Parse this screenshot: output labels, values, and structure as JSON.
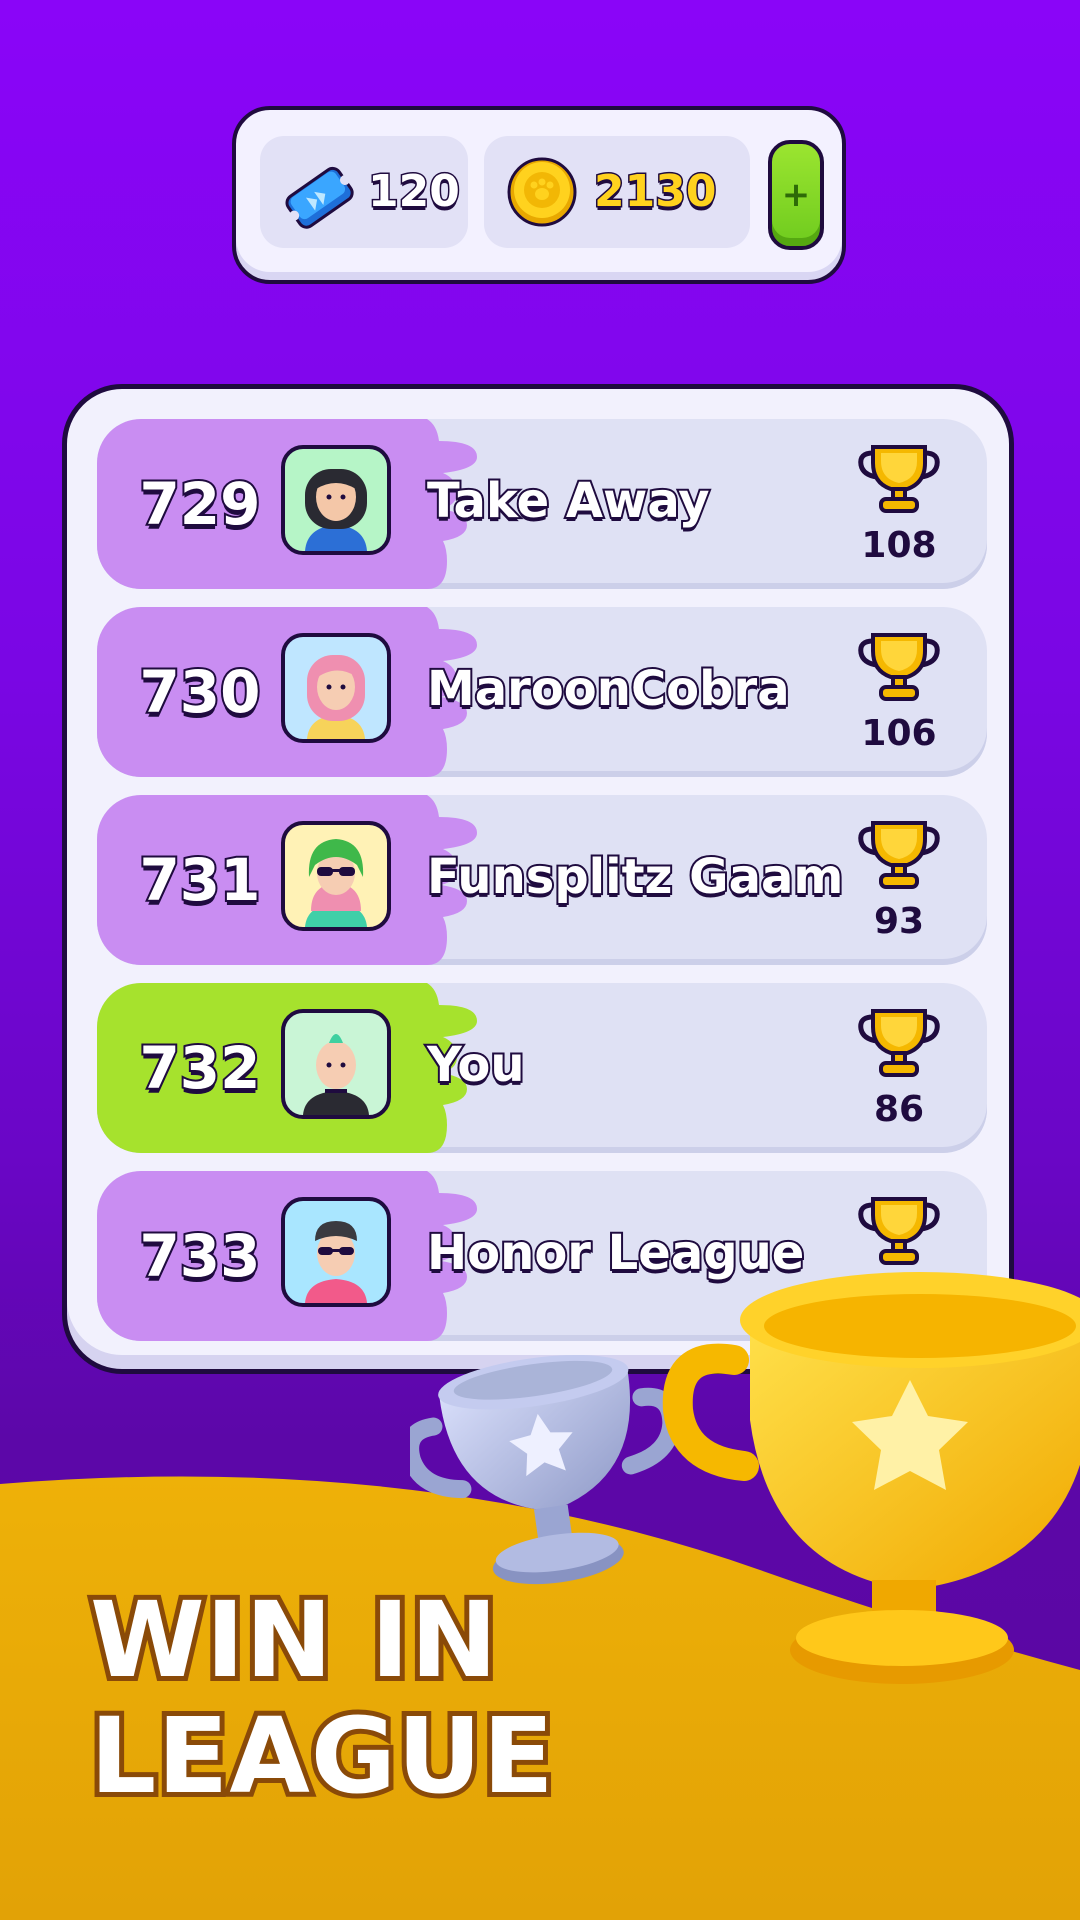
{
  "currency": {
    "tickets_icon": "ticket-icon",
    "tickets": "120",
    "coins_icon": "coin-icon",
    "coins": "2130",
    "add_label": "+"
  },
  "leaderboard": {
    "rows": [
      {
        "rank": "729",
        "name": "Take Away",
        "trophies": "108",
        "highlight": "#c98df2"
      },
      {
        "rank": "730",
        "name": "MaroonCobra",
        "trophies": "106",
        "highlight": "#c98df2"
      },
      {
        "rank": "731",
        "name": "Funsplitz Gaam",
        "trophies": "93",
        "highlight": "#c98df2"
      },
      {
        "rank": "732",
        "name": "You",
        "trophies": "86",
        "highlight": "#a6e22d"
      },
      {
        "rank": "733",
        "name": "Honor League",
        "trophies": "",
        "highlight": "#c98df2"
      }
    ]
  },
  "headline": {
    "line1": "WIN IN",
    "line2": "LEAGUE"
  },
  "colors": {
    "background_top": "#8a05f8",
    "ground": "#e6ab06",
    "gold": "#ffc81a",
    "silver": "#aab4d8",
    "outline": "#1f0b3f"
  }
}
